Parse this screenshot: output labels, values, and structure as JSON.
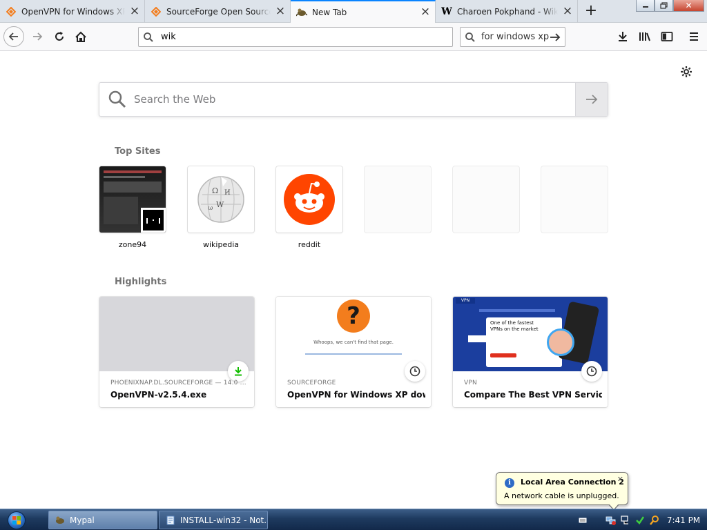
{
  "browser": {
    "tabs": [
      {
        "title": "OpenVPN for Windows XP d",
        "favicon": "sourceforge-favicon",
        "active": false
      },
      {
        "title": "SourceForge Open Source A",
        "favicon": "sourceforge-favicon",
        "active": false
      },
      {
        "title": "New Tab",
        "favicon": "mypal-favicon",
        "active": true
      },
      {
        "title": "Charoen Pokphand - Wikipe",
        "favicon": "wikipedia-favicon",
        "active": false
      }
    ],
    "urlbar_value": "wik",
    "searchbar_value": "for windows xp"
  },
  "newtab": {
    "search_placeholder": "Search the Web",
    "top_sites_title": "Top Sites",
    "top_sites": [
      {
        "label": "zone94"
      },
      {
        "label": "wikipedia"
      },
      {
        "label": "reddit"
      },
      {
        "label": ""
      },
      {
        "label": ""
      },
      {
        "label": ""
      }
    ],
    "highlights_title": "Highlights",
    "highlights": [
      {
        "source": "PHOENIXNAP.DL.SOURCEFORGE — 14.0 ...",
        "title": "OpenVPN-v2.5.4.exe",
        "badge": "download-icon"
      },
      {
        "source": "SOURCEFORGE",
        "title": "OpenVPN for Windows XP down...",
        "badge": "clock-icon",
        "preview_text": "Whoops, we can't find that page."
      },
      {
        "source": "VPN",
        "title": "Compare The Best VPN Services...",
        "badge": "clock-icon",
        "preview_text": "One of the fastest VPNs on the market"
      }
    ]
  },
  "notification": {
    "title": "Local Area Connection 2",
    "message": "A network cable is unplugged."
  },
  "taskbar": {
    "buttons": [
      {
        "label": "Mypal",
        "active": true
      },
      {
        "label": "INSTALL-win32 - Not...",
        "active": false
      }
    ],
    "clock": "7:41 PM"
  },
  "colors": {
    "accent": "#0a84ff",
    "reddit": "#ff4500",
    "download_green": "#12bc00",
    "sourceforge_orange": "#f37d1d",
    "vpn_blue": "#1b3e9e"
  }
}
